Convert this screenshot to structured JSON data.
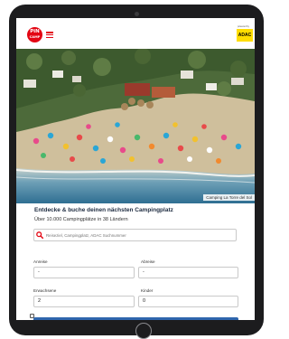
{
  "header": {
    "logo_line1": "PiN",
    "logo_line2": "CAMP",
    "partner_tag": "powered by",
    "partner_logo": "ADAC"
  },
  "hero": {
    "caption": "Camping La Torre del Sol"
  },
  "search_panel": {
    "headline": "Entdecke & buche deinen nächsten Campingplatz",
    "subline": "Über 10.000 Campingplätze in 38 Ländern",
    "search_placeholder": "Reiseziel, Campingplatz, ADAC Suchnummer",
    "arrival_label": "Anreise",
    "arrival_value": "-",
    "departure_label": "Abreise",
    "departure_value": "-",
    "adults_label": "Erwachsene",
    "adults_value": "2",
    "children_label": "Kinder",
    "children_value": "0",
    "search_button_label": ""
  },
  "colors": {
    "brand_red": "#e30613",
    "adac_yellow": "#ffdd00",
    "button_blue": "#2f66ad",
    "device_frame": "#1c1c1e"
  }
}
